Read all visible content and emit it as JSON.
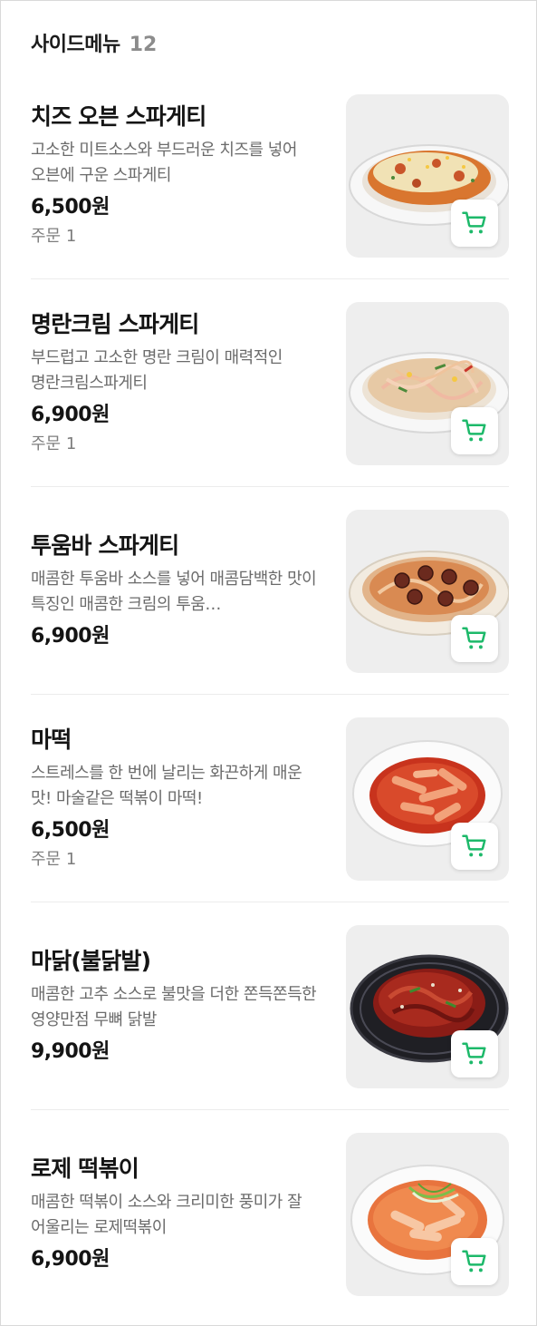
{
  "section": {
    "title": "사이드메뉴",
    "count": "12"
  },
  "colors": {
    "cart_green": "#1db96a",
    "thumb_bg": "#eeeeee"
  },
  "items": [
    {
      "name": "치즈 오븐 스파게티",
      "description": "고소한 미트소스와 부드러운 치즈를 넣어 오븐에 구운 스파게티",
      "price": "6,500원",
      "orders": "주문 1",
      "image_icon": "oven-spaghetti-dish",
      "cart_icon": "cart-icon"
    },
    {
      "name": "명란크림 스파게티",
      "description": "부드럽고 고소한 명란 크림이 매력적인 명란크림스파게티",
      "price": "6,900원",
      "orders": "주문 1",
      "image_icon": "cream-spaghetti-dish",
      "cart_icon": "cart-icon"
    },
    {
      "name": "투움바 스파게티",
      "description": "매콤한 투움바 소스를 넣어 매콤담백한 맛이 특징인 매콤한 크림의 투움…",
      "price": "6,900원",
      "image_icon": "toowoomba-spaghetti-dish",
      "cart_icon": "cart-icon"
    },
    {
      "name": "마떡",
      "description": "스트레스를 한 번에 날리는 화끈하게 매운 맛! 마술같은 떡볶이 마떡!",
      "price": "6,500원",
      "orders": "주문 1",
      "image_icon": "tteokbokki-bowl",
      "cart_icon": "cart-icon"
    },
    {
      "name": "마닭(불닭발)",
      "description": "매콤한 고추 소스로 불맛을 더한 쫀득쫀득한 영양만점 무뼈 닭발",
      "price": "9,900원",
      "image_icon": "spicy-chicken-feet-plate",
      "cart_icon": "cart-icon"
    },
    {
      "name": "로제 떡볶이",
      "description": "매콤한 떡볶이 소스와 크리미한 풍미가 잘 어울리는 로제떡볶이",
      "price": "6,900원",
      "image_icon": "rose-tteokbokki-bowl",
      "cart_icon": "cart-icon"
    }
  ]
}
